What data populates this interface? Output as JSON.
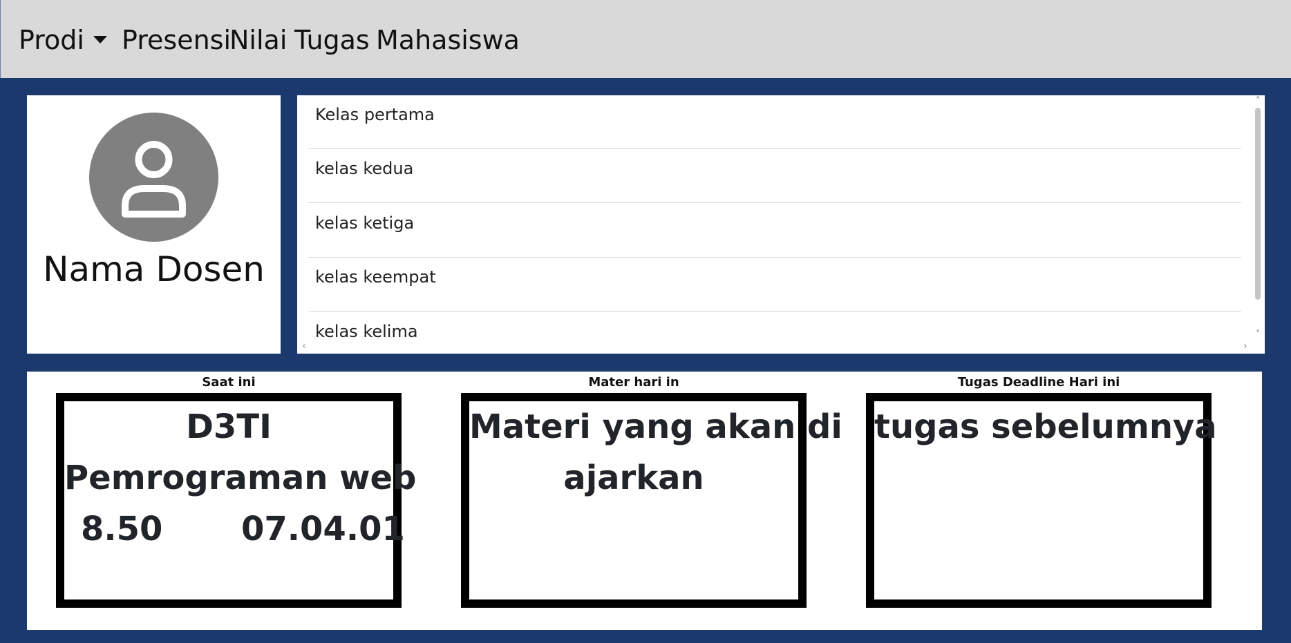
{
  "navbar": {
    "items": [
      "Prodi",
      "Presensi",
      "Nilai",
      "Tugas",
      "Mahasiswa"
    ],
    "dropdown_icon": "caret-down-icon"
  },
  "profile": {
    "avatar_icon": "user-icon",
    "name": "Nama Dosen"
  },
  "classes": [
    "Kelas pertama",
    "kelas kedua",
    "kelas ketiga",
    "kelas keempat",
    "kelas kelima"
  ],
  "scrollbar": {
    "up": "˄",
    "down": "˅",
    "left": "‹",
    "right": "›"
  },
  "cards": {
    "current": {
      "title": "Saat ini",
      "program": "D3TI",
      "course": "Pemrograman web",
      "time": "8.50",
      "room": "07.04.01"
    },
    "material": {
      "title": "Mater hari in",
      "line1": "Materi yang akan di",
      "line2": "ajarkan"
    },
    "deadline": {
      "title": "Tugas Deadline Hari ini",
      "text": "tugas sebelumnya"
    }
  },
  "colors": {
    "background": "#1c396e",
    "navbar": "#d9d9d9",
    "avatar": "#808080"
  }
}
